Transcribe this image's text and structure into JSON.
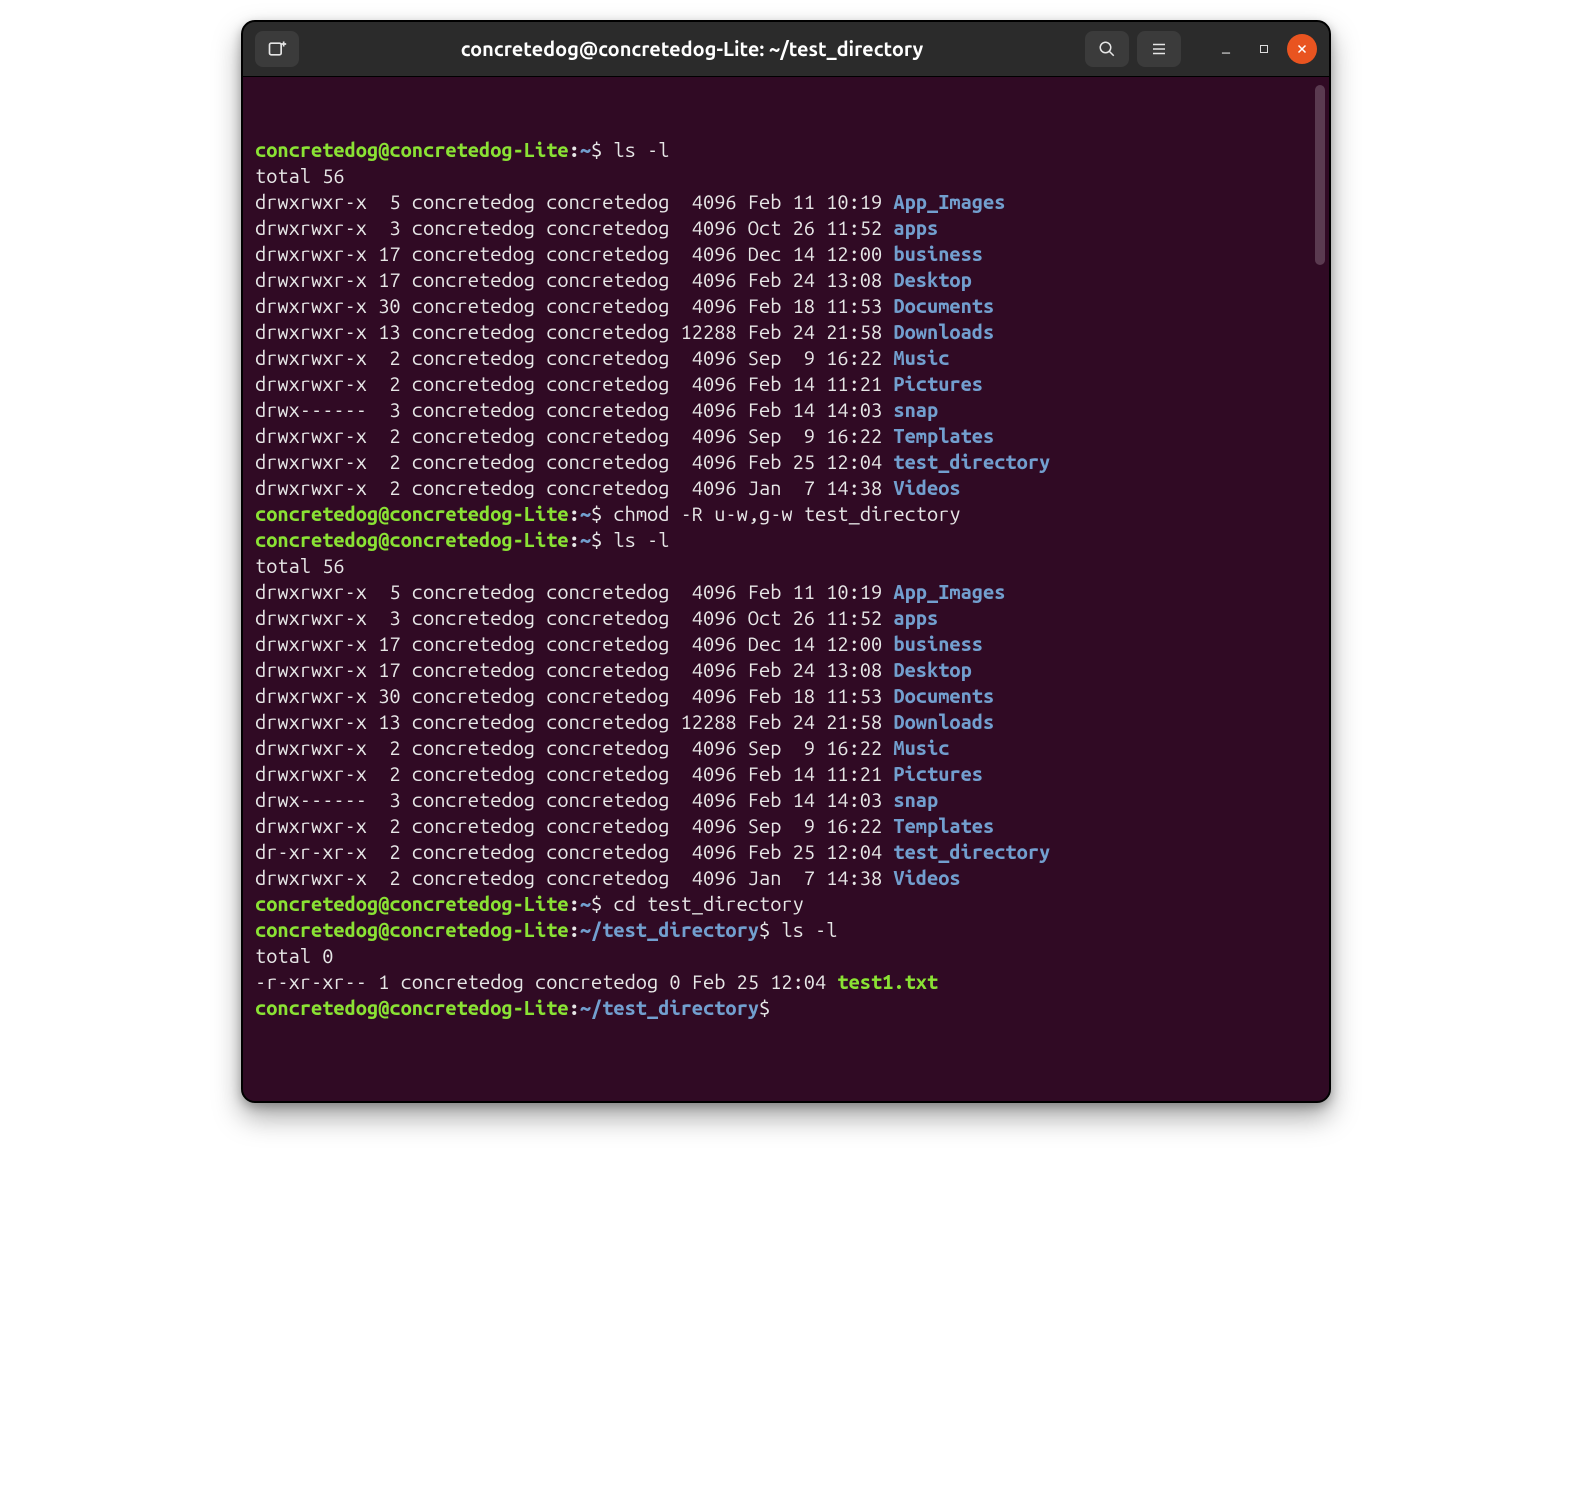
{
  "title": "concretedog@concretedog-Lite: ~/test_directory",
  "prompts": {
    "home": {
      "user": "concretedog",
      "at": "@",
      "host": "concretedog-Lite",
      "colon": ":",
      "path": "~",
      "dollar": "$"
    },
    "td": {
      "user": "concretedog",
      "at": "@",
      "host": "concretedog-Lite",
      "colon": ":",
      "path": "~/test_directory",
      "dollar": "$"
    }
  },
  "commands": {
    "ls_l": "ls -l",
    "chmod": "chmod -R u-w,g-w test_directory",
    "cd": "cd test_directory"
  },
  "totals": {
    "t56": "total 56",
    "t0": "total 0"
  },
  "listing1": [
    {
      "perm": "drwxrwxr-x",
      "links": "5",
      "user": "concretedog",
      "group": "concretedog",
      "size": "4096",
      "date": "Feb 11 10:19",
      "name": "App_Images",
      "cls": "dir"
    },
    {
      "perm": "drwxrwxr-x",
      "links": "3",
      "user": "concretedog",
      "group": "concretedog",
      "size": "4096",
      "date": "Oct 26 11:52",
      "name": "apps",
      "cls": "dir"
    },
    {
      "perm": "drwxrwxr-x",
      "links": "17",
      "user": "concretedog",
      "group": "concretedog",
      "size": "4096",
      "date": "Dec 14 12:00",
      "name": "business",
      "cls": "dir"
    },
    {
      "perm": "drwxrwxr-x",
      "links": "17",
      "user": "concretedog",
      "group": "concretedog",
      "size": "4096",
      "date": "Feb 24 13:08",
      "name": "Desktop",
      "cls": "dir"
    },
    {
      "perm": "drwxrwxr-x",
      "links": "30",
      "user": "concretedog",
      "group": "concretedog",
      "size": "4096",
      "date": "Feb 18 11:53",
      "name": "Documents",
      "cls": "dir"
    },
    {
      "perm": "drwxrwxr-x",
      "links": "13",
      "user": "concretedog",
      "group": "concretedog",
      "size": "12288",
      "date": "Feb 24 21:58",
      "name": "Downloads",
      "cls": "dir"
    },
    {
      "perm": "drwxrwxr-x",
      "links": "2",
      "user": "concretedog",
      "group": "concretedog",
      "size": "4096",
      "date": "Sep  9 16:22",
      "name": "Music",
      "cls": "dir"
    },
    {
      "perm": "drwxrwxr-x",
      "links": "2",
      "user": "concretedog",
      "group": "concretedog",
      "size": "4096",
      "date": "Feb 14 11:21",
      "name": "Pictures",
      "cls": "dir"
    },
    {
      "perm": "drwx------",
      "links": "3",
      "user": "concretedog",
      "group": "concretedog",
      "size": "4096",
      "date": "Feb 14 14:03",
      "name": "snap",
      "cls": "dir"
    },
    {
      "perm": "drwxrwxr-x",
      "links": "2",
      "user": "concretedog",
      "group": "concretedog",
      "size": "4096",
      "date": "Sep  9 16:22",
      "name": "Templates",
      "cls": "dir"
    },
    {
      "perm": "drwxrwxr-x",
      "links": "2",
      "user": "concretedog",
      "group": "concretedog",
      "size": "4096",
      "date": "Feb 25 12:04",
      "name": "test_directory",
      "cls": "dir"
    },
    {
      "perm": "drwxrwxr-x",
      "links": "2",
      "user": "concretedog",
      "group": "concretedog",
      "size": "4096",
      "date": "Jan  7 14:38",
      "name": "Videos",
      "cls": "dir"
    }
  ],
  "listing2": [
    {
      "perm": "drwxrwxr-x",
      "links": "5",
      "user": "concretedog",
      "group": "concretedog",
      "size": "4096",
      "date": "Feb 11 10:19",
      "name": "App_Images",
      "cls": "dir"
    },
    {
      "perm": "drwxrwxr-x",
      "links": "3",
      "user": "concretedog",
      "group": "concretedog",
      "size": "4096",
      "date": "Oct 26 11:52",
      "name": "apps",
      "cls": "dir"
    },
    {
      "perm": "drwxrwxr-x",
      "links": "17",
      "user": "concretedog",
      "group": "concretedog",
      "size": "4096",
      "date": "Dec 14 12:00",
      "name": "business",
      "cls": "dir"
    },
    {
      "perm": "drwxrwxr-x",
      "links": "17",
      "user": "concretedog",
      "group": "concretedog",
      "size": "4096",
      "date": "Feb 24 13:08",
      "name": "Desktop",
      "cls": "dir"
    },
    {
      "perm": "drwxrwxr-x",
      "links": "30",
      "user": "concretedog",
      "group": "concretedog",
      "size": "4096",
      "date": "Feb 18 11:53",
      "name": "Documents",
      "cls": "dir"
    },
    {
      "perm": "drwxrwxr-x",
      "links": "13",
      "user": "concretedog",
      "group": "concretedog",
      "size": "12288",
      "date": "Feb 24 21:58",
      "name": "Downloads",
      "cls": "dir"
    },
    {
      "perm": "drwxrwxr-x",
      "links": "2",
      "user": "concretedog",
      "group": "concretedog",
      "size": "4096",
      "date": "Sep  9 16:22",
      "name": "Music",
      "cls": "dir"
    },
    {
      "perm": "drwxrwxr-x",
      "links": "2",
      "user": "concretedog",
      "group": "concretedog",
      "size": "4096",
      "date": "Feb 14 11:21",
      "name": "Pictures",
      "cls": "dir"
    },
    {
      "perm": "drwx------",
      "links": "3",
      "user": "concretedog",
      "group": "concretedog",
      "size": "4096",
      "date": "Feb 14 14:03",
      "name": "snap",
      "cls": "dir"
    },
    {
      "perm": "drwxrwxr-x",
      "links": "2",
      "user": "concretedog",
      "group": "concretedog",
      "size": "4096",
      "date": "Sep  9 16:22",
      "name": "Templates",
      "cls": "dir"
    },
    {
      "perm": "dr-xr-xr-x",
      "links": "2",
      "user": "concretedog",
      "group": "concretedog",
      "size": "4096",
      "date": "Feb 25 12:04",
      "name": "test_directory",
      "cls": "dir"
    },
    {
      "perm": "drwxrwxr-x",
      "links": "2",
      "user": "concretedog",
      "group": "concretedog",
      "size": "4096",
      "date": "Jan  7 14:38",
      "name": "Videos",
      "cls": "dir"
    }
  ],
  "listing3": [
    {
      "perm": "-r-xr-xr--",
      "links": "1",
      "user": "concretedog",
      "group": "concretedog",
      "size": "0",
      "date": "Feb 25 12:04",
      "name": "test1.txt",
      "cls": "file-exec"
    }
  ]
}
